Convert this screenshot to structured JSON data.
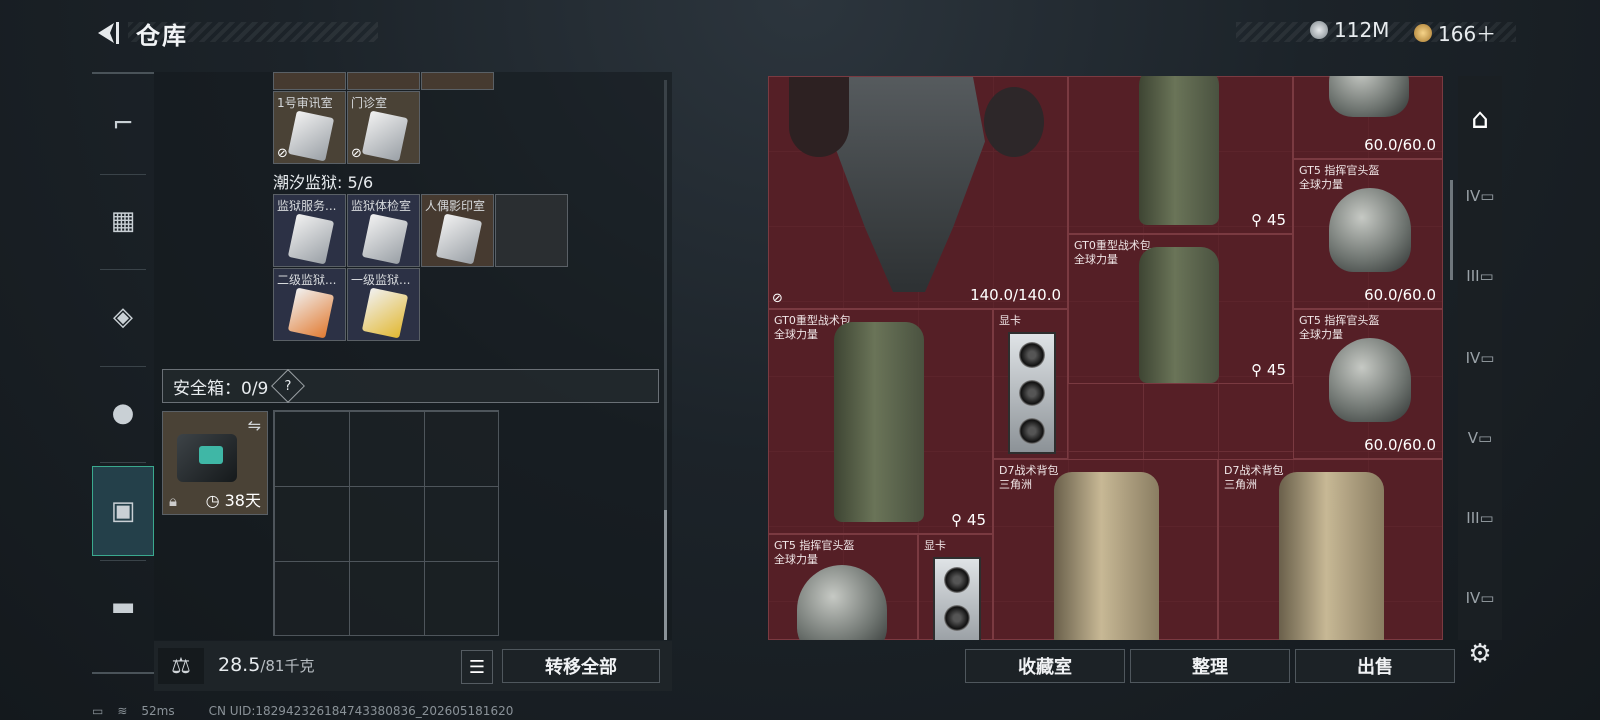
{
  "header": {
    "title": "仓库",
    "currency_silver": "112M",
    "currency_gold": "166＋"
  },
  "inventory": {
    "keys_row0": [
      "1号审讯室",
      "门诊室"
    ],
    "prison_section": "潮汐监狱: 5/6",
    "prison_row1": [
      "监狱服务...",
      "监狱体检室",
      "人偶影印室"
    ],
    "prison_row2": [
      "二级监狱...",
      "一级监狱..."
    ],
    "safe_label": "安全箱：0/9",
    "safe_help": "?",
    "safe_days": "38天"
  },
  "bottom_left": {
    "weight": "28.5",
    "weight_max": "/81千克",
    "transfer_all": "转移全部"
  },
  "storage": {
    "items": [
      {
        "name": "",
        "sub": "",
        "durability": "140.0/140.0"
      },
      {
        "name": "",
        "sub": "",
        "capacity": "45"
      },
      {
        "name": "",
        "sub": "",
        "durability": "60.0/60.0"
      },
      {
        "name": "GT5 指挥官头盔",
        "sub": "全球力量",
        "durability": "60.0/60.0"
      },
      {
        "name": "GT0重型战术包",
        "sub": "全球力量",
        "capacity": "45"
      },
      {
        "name": "GT0重型战术包",
        "sub": "全球力量",
        "capacity": "45"
      },
      {
        "name": "显卡",
        "sub": ""
      },
      {
        "name": "GT5 指挥官头盔",
        "sub": "全球力量",
        "durability": "60.0/60.0"
      },
      {
        "name": "D7战术背包",
        "sub": "三角洲"
      },
      {
        "name": "D7战术背包",
        "sub": "三角洲"
      },
      {
        "name": "GT5 指挥官头盔",
        "sub": "全球力量"
      },
      {
        "name": "显卡",
        "sub": ""
      }
    ]
  },
  "bottom_right": {
    "collection": "收藏室",
    "organize": "整理",
    "sell": "出售"
  },
  "status": {
    "ping": "52ms",
    "uid": "CN UID:182942326184743380836_202605181620"
  },
  "colors": {
    "storage_bg": "#561f26",
    "accent": "#3aa98e"
  }
}
